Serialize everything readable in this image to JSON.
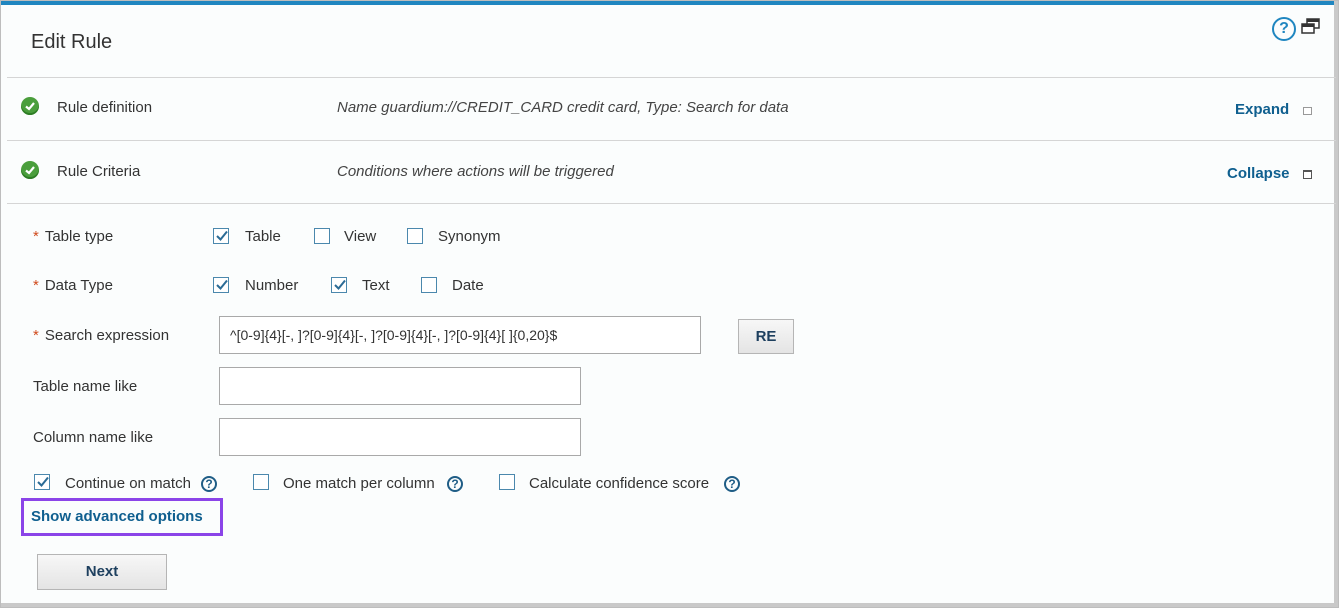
{
  "panel": {
    "title": "Edit Rule"
  },
  "header_icons": {
    "help": "?",
    "help_icon": "help-circle-icon",
    "restore_icon": "restore-window-icon"
  },
  "sections": [
    {
      "label": "Rule definition",
      "description": "Name guardium://CREDIT_CARD credit card, Type: Search for data",
      "action": "Expand",
      "status_icon": "check-circle-icon"
    },
    {
      "label": "Rule Criteria",
      "description": "Conditions where actions will be triggered",
      "action": "Collapse",
      "status_icon": "check-circle-icon"
    }
  ],
  "form": {
    "required_mark": "*",
    "table_type": {
      "label": "Table type",
      "options": [
        {
          "label": "Table",
          "checked": true
        },
        {
          "label": "View",
          "checked": false
        },
        {
          "label": "Synonym",
          "checked": false
        }
      ]
    },
    "data_type": {
      "label": "Data Type",
      "options": [
        {
          "label": "Number",
          "checked": true
        },
        {
          "label": "Text",
          "checked": true
        },
        {
          "label": "Date",
          "checked": false
        }
      ]
    },
    "search_expression": {
      "label": "Search expression",
      "value": "^[0-9]{4}[-, ]?[0-9]{4}[-, ]?[0-9]{4}[-, ]?[0-9]{4}[ ]{0,20}$",
      "re_button": "RE"
    },
    "table_name_like": {
      "label": "Table name like",
      "value": ""
    },
    "column_name_like": {
      "label": "Column name like",
      "value": ""
    },
    "options": [
      {
        "label": "Continue on match",
        "checked": true
      },
      {
        "label": "One match per column",
        "checked": false
      },
      {
        "label": "Calculate confidence score",
        "checked": false
      }
    ],
    "help_mark": "?",
    "advanced_link": "Show advanced options",
    "next_button": "Next"
  },
  "colors": {
    "accent": "#1f86c0",
    "link": "#0f5f8f",
    "required": "#d04a1d",
    "success": "#4a9e3c",
    "highlight": "#8b44e8"
  }
}
